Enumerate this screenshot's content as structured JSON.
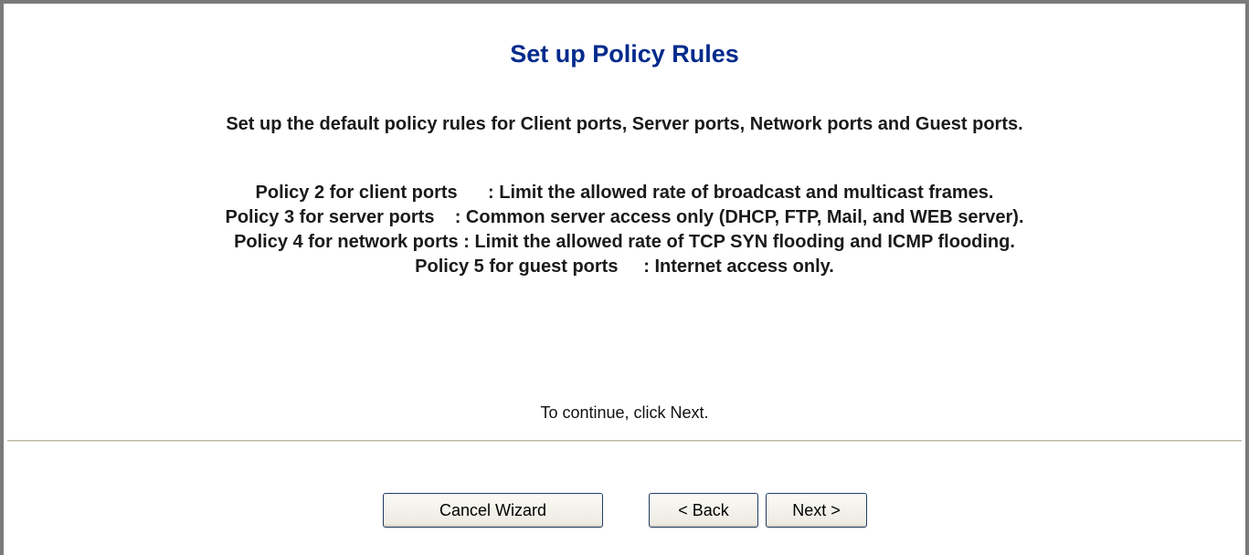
{
  "page": {
    "title": "Set up Policy Rules",
    "intro": "Set up the default policy rules for Client ports, Server ports, Network ports and Guest ports.",
    "policies": [
      "Policy 2 for client ports      : Limit the allowed rate of broadcast and multicast frames.",
      "Policy 3 for server ports    : Common server access only (DHCP, FTP, Mail, and WEB server).",
      "Policy 4 for network ports : Limit the allowed rate of TCP SYN flooding and ICMP flooding.",
      "Policy 5 for guest ports     : Internet access only."
    ],
    "continue_text": "To continue, click Next."
  },
  "buttons": {
    "cancel_label": "Cancel Wizard",
    "back_label": "< Back",
    "next_label": "Next >"
  },
  "colors": {
    "title": "#002a8c",
    "frame_border": "#7a7a7a",
    "button_border": "#1f3b60"
  }
}
